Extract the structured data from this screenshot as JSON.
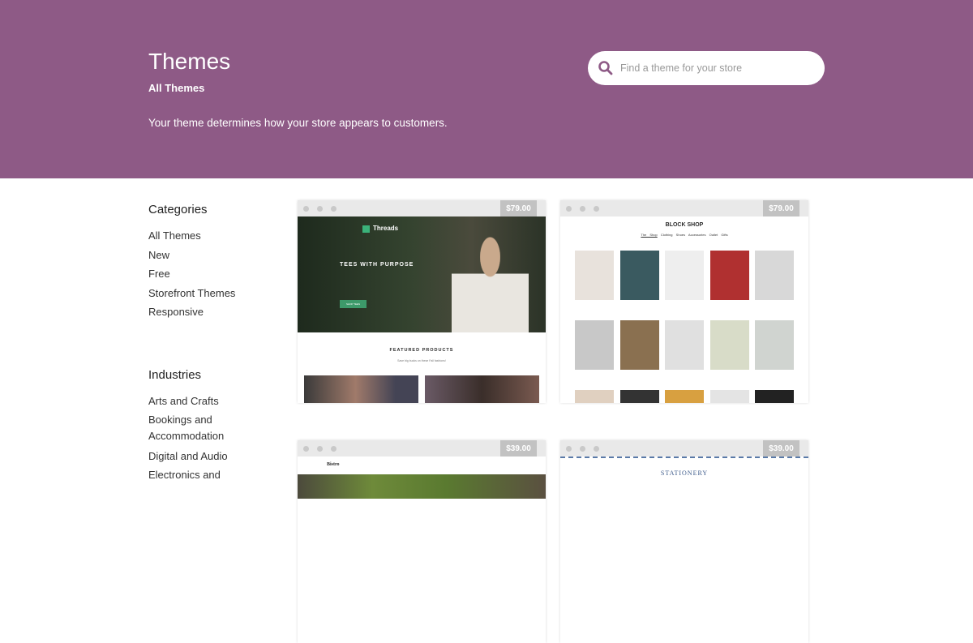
{
  "header": {
    "title": "Themes",
    "subtitle": "All Themes",
    "description": "Your theme determines how your store appears to customers.",
    "accent": "#8e5a86"
  },
  "search": {
    "placeholder": "Find a theme for your store",
    "icon": "search-icon"
  },
  "categories": {
    "heading": "Categories",
    "items": [
      "All Themes",
      "New",
      "Free",
      "Storefront Themes",
      "Responsive"
    ]
  },
  "industries": {
    "heading": "Industries",
    "items": [
      "Arts and Crafts",
      "Bookings and Accommodation",
      "Digital and Audio",
      "Electronics and"
    ]
  },
  "themes": [
    {
      "name": "Threads",
      "price": "$79.00",
      "hero": "TEES WITH PURPOSE",
      "button": "SHOP TEES",
      "section": "FEATURED PRODUCTS",
      "section_sub": "Save big bucks on these Fall fashions!"
    },
    {
      "name": "BLOCK SHOP",
      "price": "$79.00",
      "nav": [
        "The Shop",
        "Clothing",
        "Shoes",
        "Accessories",
        "Outlet",
        "Gifts"
      ]
    },
    {
      "name": "Bistro",
      "price": "$39.00"
    },
    {
      "name": "STATIONERY",
      "price": "$39.00"
    }
  ]
}
